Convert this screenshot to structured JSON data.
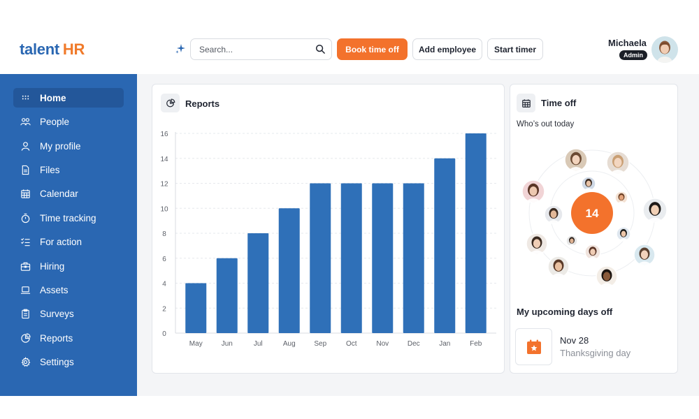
{
  "brand": {
    "logo_text_1": "talent",
    "logo_text_2": "HR",
    "primary_color": "#2a67b2",
    "accent_color": "#f3722c"
  },
  "search": {
    "placeholder": "Search...",
    "value": ""
  },
  "header": {
    "book_time_off": "Book time off",
    "add_employee": "Add employee",
    "start_timer": "Start timer",
    "sparkle_icon": "sparkle-icon",
    "search_icon": "magnifier-icon"
  },
  "user": {
    "name": "Michaela",
    "role": "Admin"
  },
  "sidebar": {
    "items": [
      {
        "label": "Home",
        "icon": "grid-icon",
        "active": true
      },
      {
        "label": "People",
        "icon": "people-icon"
      },
      {
        "label": "My profile",
        "icon": "user-icon"
      },
      {
        "label": "Files",
        "icon": "file-icon"
      },
      {
        "label": "Calendar",
        "icon": "calendar-icon"
      },
      {
        "label": "Time tracking",
        "icon": "stopwatch-icon"
      },
      {
        "label": "For action",
        "icon": "checklist-icon"
      },
      {
        "label": "Hiring",
        "icon": "briefcase-icon"
      },
      {
        "label": "Assets",
        "icon": "laptop-icon"
      },
      {
        "label": "Surveys",
        "icon": "clipboard-icon"
      },
      {
        "label": "Reports",
        "icon": "pie-chart-icon"
      },
      {
        "label": "Settings",
        "icon": "gear-icon"
      }
    ]
  },
  "reports": {
    "title": "Reports",
    "icon": "pie-chart-icon"
  },
  "chart_data": {
    "type": "bar",
    "categories": [
      "May",
      "Jun",
      "Jul",
      "Aug",
      "Sep",
      "Oct",
      "Nov",
      "Dec",
      "Jan",
      "Feb"
    ],
    "values": [
      4,
      6,
      8,
      10,
      12,
      12,
      12,
      12,
      14,
      16
    ],
    "yticks": [
      "0",
      "2",
      "4",
      "6",
      "8",
      "10",
      "12",
      "14",
      "16"
    ],
    "ylim": [
      0,
      16
    ],
    "bar_color": "#2f70b8",
    "grid": "dashed horizontal"
  },
  "time_off": {
    "title": "Time off",
    "icon": "calendar-icon",
    "subtitle": "Who’s out today",
    "count": "14",
    "count_color": "#f3722c",
    "upcoming_title": "My upcoming days off",
    "upcoming": [
      {
        "date": "Nov 28",
        "name": "Thanksgiving day",
        "icon": "calendar-star-icon"
      }
    ]
  }
}
